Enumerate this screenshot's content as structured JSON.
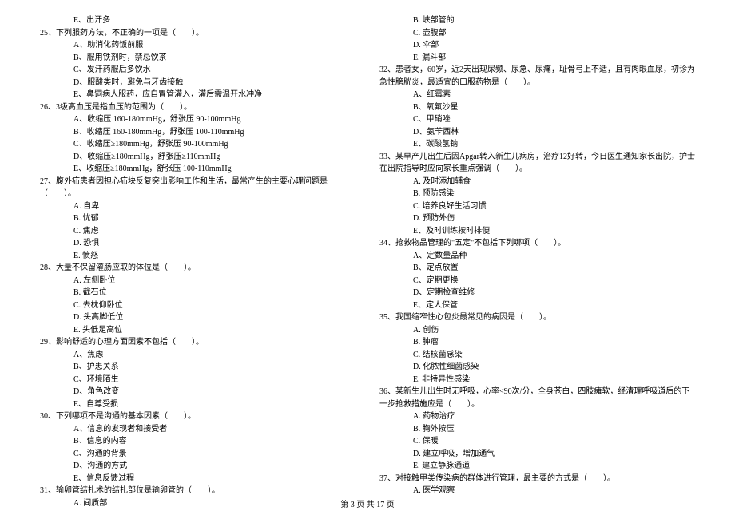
{
  "left_column": {
    "q24_e": "E、出汗多",
    "q25": {
      "stem": "25、下列服药方法，不正确的一项是（　　）。",
      "options": [
        "A、助消化药饭前服",
        "B、服用铁剂时，禁忌饮茶",
        "C、发汗药服后多饮水",
        "D、服酸类时，避免与牙齿接触",
        "E、鼻饲病人服药，应自胃管灌入，灌后需温开水冲净"
      ]
    },
    "q26": {
      "stem": "26、3级高血压是指血压的范围为（　　）。",
      "options": [
        "A、收缩压 160-180mmHg，舒张压 90-100mmHg",
        "B、收缩压 160-180mmHg，舒张压 100-110mmHg",
        "C、收缩压≥180mmHg，舒张压 90-100mmHg",
        "D、收缩压≥180mmHg，舒张压≥110mmHg",
        "E、收缩压≥180mmHg，舒张压 100-110mmHg"
      ]
    },
    "q27": {
      "stem": "27、腹外疝患者因担心疝块反复突出影响工作和生活，最常产生的主要心理问题是（　　）。",
      "options": [
        "A. 自卑",
        "B. 忧郁",
        "C. 焦虑",
        "D. 恐惧",
        "E. 愤怒"
      ]
    },
    "q28": {
      "stem": "28、大量不保留灌肠应取的体位是（　　）。",
      "options": [
        "A. 左侧卧位",
        "B. 截石位",
        "C. 去枕仰卧位",
        "D. 头高脚低位",
        "E. 头低足高位"
      ]
    },
    "q29": {
      "stem": "29、影响舒适的心理方面因素不包括（　　）。",
      "options": [
        "A、焦虑",
        "B、护患关系",
        "C、环境陌生",
        "D、角色改变",
        "E、自尊受损"
      ]
    },
    "q30": {
      "stem": "30、下列哪项不是沟通的基本因素（　　）。",
      "options": [
        "A、信息的发现者和接受者",
        "B、信息的内容",
        "C、沟通的背景",
        "D、沟通的方式",
        "E、信息反馈过程"
      ]
    },
    "q31": {
      "stem": "31、输卵管结扎术的结扎部位是输卵管的（　　）。",
      "options_partial": [
        "A. 间质部"
      ]
    }
  },
  "right_column": {
    "q31_cont": [
      "B. 峡部管的",
      "C. 壶腹部",
      "D. 伞部",
      "E. 漏斗部"
    ],
    "q32": {
      "stem": "32、患者女，60岁，近2天出现尿频、尿急、尿痛，耻骨弓上不适，且有肉眼血尿，初诊为急性膀胱炎，最适宜的口服药物是（　　）。",
      "options": [
        "A、红霉素",
        "B、氧氟沙星",
        "C、甲硝唑",
        "D、氨苄西林",
        "E、碳酸氢钠"
      ]
    },
    "q33": {
      "stem": "33、某早产儿出生后因Apgar转入新生儿病房，治疗12好转，今日医生通知家长出院，护士在出院指导时应向家长重点强调（　　）。",
      "options": [
        "A. 及时添加辅食",
        "B. 预防感染",
        "C. 培养良好生活习惯",
        "D. 预防外伤",
        "E、及时训练按时排便"
      ]
    },
    "q34": {
      "stem": "34、抢救物品管理的\"五定\"不包括下列哪项（　　）。",
      "options": [
        "A、定数量品种",
        "B、定点放置",
        "C、定期更换",
        "D、定期检查维修",
        "E、定人保管"
      ]
    },
    "q35": {
      "stem": "35、我国缩窄性心包炎最常见的病因是（　　）。",
      "options": [
        "A. 创伤",
        "B. 肿瘤",
        "C. 结核菌感染",
        "D. 化脓性细菌感染",
        "E. 非特异性感染"
      ]
    },
    "q36": {
      "stem": "36、某新生儿出生时无呼吸，心率<90次/分，全身苍白，四肢瘫软，经清理呼吸道后的下一步抢救措施应是（　　）。",
      "options": [
        "A. 药物治疗",
        "B. 胸外按压",
        "C. 保暖",
        "D. 建立呼吸，增加通气",
        "E. 建立静脉通道"
      ]
    },
    "q37": {
      "stem": "37、对接触甲类传染病的群体进行管理，最主要的方式是（　　）。",
      "options_partial": [
        "A. 医学观察"
      ]
    }
  },
  "footer": "第 3 页 共 17 页"
}
